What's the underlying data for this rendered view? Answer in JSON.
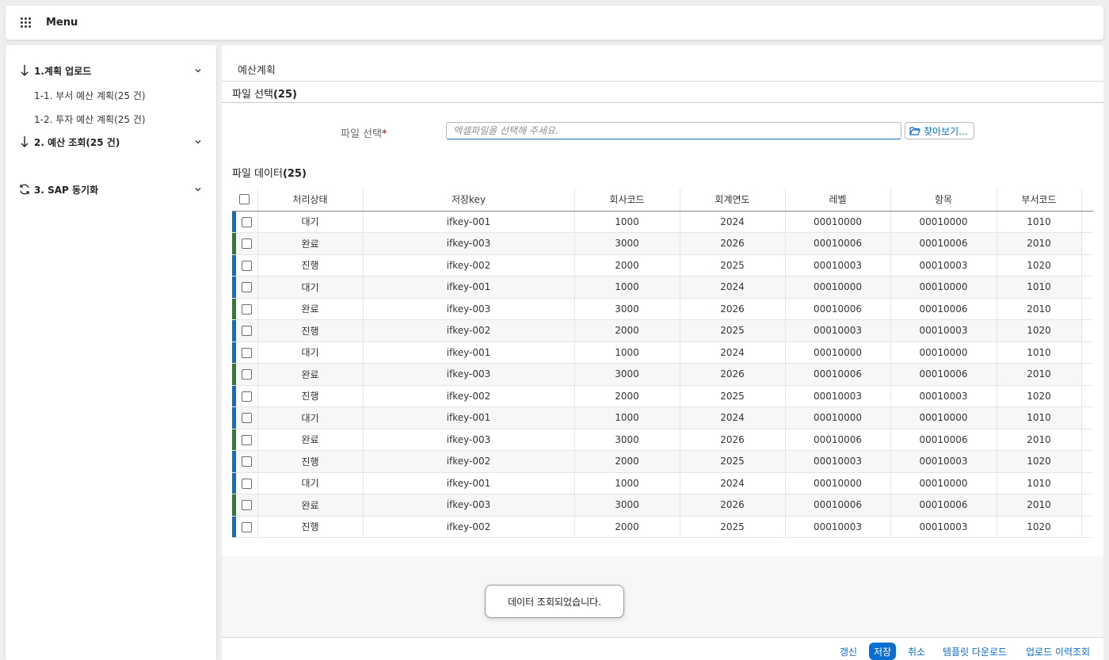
{
  "topbar": {
    "menu_label": "Menu"
  },
  "sidebar": {
    "groups": [
      {
        "label": "1.계획 업로드",
        "icon": "arrow-down-icon"
      },
      {
        "label": "2. 예산 조회(25 건)",
        "icon": "arrow-down-icon"
      },
      {
        "label": "3. SAP 동기화",
        "icon": "sync-icon"
      }
    ],
    "subitems": [
      {
        "label": "1-1. 부서 예산 계획(25 건)"
      },
      {
        "label": "1-2. 투자 예산 계획(25 건)"
      }
    ]
  },
  "main": {
    "title": "예산계획",
    "file_section": {
      "label": "파일 선택",
      "count": "(25)"
    },
    "file_field": {
      "label": "파일 선택",
      "required": "*",
      "placeholder": "엑셀파일을 선택해 주세요.",
      "browse_label": "찾아보기..."
    },
    "data_section": {
      "label": "파일 데이터",
      "count": "(25)"
    }
  },
  "table": {
    "headers": [
      "처리상태",
      "저장key",
      "회사코드",
      "회계연도",
      "레벨",
      "항목",
      "부서코드"
    ],
    "rows": [
      {
        "status": "대기",
        "key": "ifkey-001",
        "company": "1000",
        "year": "2024",
        "level": "00010000",
        "item": "00010000",
        "dept": "1010",
        "color": "#0a6ed1"
      },
      {
        "status": "완료",
        "key": "ifkey-003",
        "company": "3000",
        "year": "2026",
        "level": "00010006",
        "item": "00010006",
        "dept": "2010",
        "color": "#2b7d2b"
      },
      {
        "status": "진행",
        "key": "ifkey-002",
        "company": "2000",
        "year": "2025",
        "level": "00010003",
        "item": "00010003",
        "dept": "1020",
        "color": "#0a6ed1"
      },
      {
        "status": "대기",
        "key": "ifkey-001",
        "company": "1000",
        "year": "2024",
        "level": "00010000",
        "item": "00010000",
        "dept": "1010",
        "color": "#0a6ed1"
      },
      {
        "status": "완료",
        "key": "ifkey-003",
        "company": "3000",
        "year": "2026",
        "level": "00010006",
        "item": "00010006",
        "dept": "2010",
        "color": "#2b7d2b"
      },
      {
        "status": "진행",
        "key": "ifkey-002",
        "company": "2000",
        "year": "2025",
        "level": "00010003",
        "item": "00010003",
        "dept": "1020",
        "color": "#0a6ed1"
      },
      {
        "status": "대기",
        "key": "ifkey-001",
        "company": "1000",
        "year": "2024",
        "level": "00010000",
        "item": "00010000",
        "dept": "1010",
        "color": "#0a6ed1"
      },
      {
        "status": "완료",
        "key": "ifkey-003",
        "company": "3000",
        "year": "2026",
        "level": "00010006",
        "item": "00010006",
        "dept": "2010",
        "color": "#2b7d2b"
      },
      {
        "status": "진행",
        "key": "ifkey-002",
        "company": "2000",
        "year": "2025",
        "level": "00010003",
        "item": "00010003",
        "dept": "1020",
        "color": "#0a6ed1"
      },
      {
        "status": "대기",
        "key": "ifkey-001",
        "company": "1000",
        "year": "2024",
        "level": "00010000",
        "item": "00010000",
        "dept": "1010",
        "color": "#0a6ed1"
      },
      {
        "status": "완료",
        "key": "ifkey-003",
        "company": "3000",
        "year": "2026",
        "level": "00010006",
        "item": "00010006",
        "dept": "2010",
        "color": "#2b7d2b"
      },
      {
        "status": "진행",
        "key": "ifkey-002",
        "company": "2000",
        "year": "2025",
        "level": "00010003",
        "item": "00010003",
        "dept": "1020",
        "color": "#0a6ed1"
      },
      {
        "status": "대기",
        "key": "ifkey-001",
        "company": "1000",
        "year": "2024",
        "level": "00010000",
        "item": "00010000",
        "dept": "1010",
        "color": "#0a6ed1"
      },
      {
        "status": "완료",
        "key": "ifkey-003",
        "company": "3000",
        "year": "2026",
        "level": "00010006",
        "item": "00010006",
        "dept": "2010",
        "color": "#2b7d2b"
      },
      {
        "status": "진행",
        "key": "ifkey-002",
        "company": "2000",
        "year": "2025",
        "level": "00010003",
        "item": "00010003",
        "dept": "1020",
        "color": "#0a6ed1"
      }
    ]
  },
  "toast": {
    "message": "데이터 조회되었습니다."
  },
  "footer": {
    "refresh_label": "갱신",
    "save_label": "저장",
    "cancel_label": "취소",
    "template_label": "템플릿 다운로드",
    "history_label": "업로드 이력조회"
  },
  "colors": {
    "accent": "#0a6ed1",
    "done": "#2b7d2b",
    "required": "#bb0000"
  }
}
